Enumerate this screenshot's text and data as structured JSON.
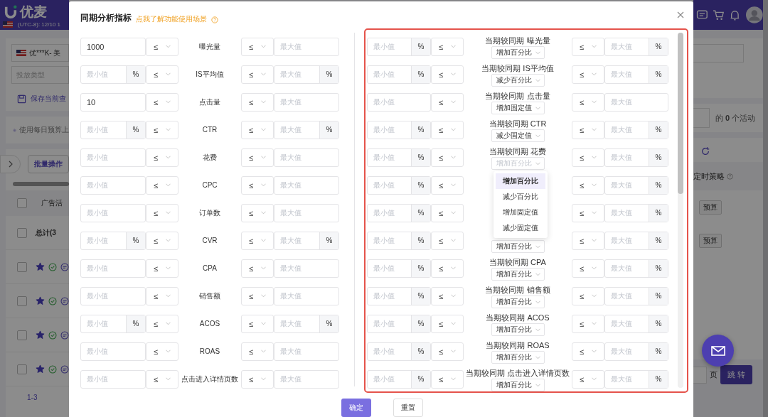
{
  "background": {
    "brand": "优麦",
    "timezone": "(UTC-8): 12/10 1",
    "store": "优***K- 美",
    "type_placeholder": "投放类型",
    "save_link": "保存当前查",
    "budget_note": "使用每日预算上",
    "batch_button": "批量操作",
    "table_header": "广告活",
    "total_row": "总计(3",
    "header_checked": false,
    "total_checked": false,
    "rows": [
      {
        "checked": false,
        "starred": true
      },
      {
        "checked": false,
        "starred": true
      },
      {
        "checked": false,
        "starred": true
      },
      {
        "checked": false,
        "starred": true
      }
    ],
    "pager": "1-3",
    "count_text": "的 **0** 个活动",
    "strategy_header": "定时策略",
    "budget_tags": [
      "预算",
      "预算"
    ],
    "page_label": "页",
    "jump_button": "跳 转"
  },
  "dialog": {
    "title": "同期分析指标",
    "help_link": "点我了解功能使用场景",
    "left_rows": [
      {
        "min_value": "1000",
        "min_op": "≤",
        "label": "曝光量",
        "max_op": "≤",
        "max_placeholder": "最大值"
      },
      {
        "min_placeholder": "最小值",
        "min_unit": "%",
        "min_op": "≤",
        "label": "IS平均值",
        "max_op": "≤",
        "max_placeholder": "最大值",
        "max_unit": "%"
      },
      {
        "min_value": "10",
        "min_op": "≤",
        "label": "点击量",
        "max_op": "≤",
        "max_placeholder": "最大值"
      },
      {
        "min_placeholder": "最小值",
        "min_unit": "%",
        "min_op": "≤",
        "label": "CTR",
        "max_op": "≤",
        "max_placeholder": "最大值",
        "max_unit": "%"
      },
      {
        "min_placeholder": "最小值",
        "min_op": "≤",
        "label": "花费",
        "max_op": "≤",
        "max_placeholder": "最大值"
      },
      {
        "min_placeholder": "最小值",
        "min_op": "≤",
        "label": "CPC",
        "max_op": "≤",
        "max_placeholder": "最大值"
      },
      {
        "min_placeholder": "最小值",
        "min_op": "≤",
        "label": "订单数",
        "max_op": "≤",
        "max_placeholder": "最大值"
      },
      {
        "min_placeholder": "最小值",
        "min_unit": "%",
        "min_op": "≤",
        "label": "CVR",
        "max_op": "≤",
        "max_placeholder": "最大值",
        "max_unit": "%"
      },
      {
        "min_placeholder": "最小值",
        "min_op": "≤",
        "label": "CPA",
        "max_op": "≤",
        "max_placeholder": "最大值"
      },
      {
        "min_placeholder": "最小值",
        "min_op": "≤",
        "label": "销售额",
        "max_op": "≤",
        "max_placeholder": "最大值"
      },
      {
        "min_placeholder": "最小值",
        "min_unit": "%",
        "min_op": "≤",
        "label": "ACOS",
        "max_op": "≤",
        "max_placeholder": "最大值",
        "max_unit": "%"
      },
      {
        "min_placeholder": "最小值",
        "min_op": "≤",
        "label": "ROAS",
        "max_op": "≤",
        "max_placeholder": "最大值"
      },
      {
        "min_placeholder": "最小值",
        "min_op": "≤",
        "label": "点击进入详情页数",
        "max_op": "≤",
        "max_placeholder": "最大值"
      }
    ],
    "right_rows": [
      {
        "min_placeholder": "最小值",
        "min_unit": "%",
        "min_op": "≤",
        "label": "当期较同期 曝光量",
        "change": "增加百分比",
        "open": false,
        "max_op": "≤",
        "max_placeholder": "最大值",
        "max_unit": "%"
      },
      {
        "min_placeholder": "最小值",
        "min_unit": "%",
        "min_op": "≤",
        "label": "当期较同期 IS平均值",
        "change": "减少百分比",
        "open": false,
        "max_op": "≤",
        "max_placeholder": "最大值",
        "max_unit": "%"
      },
      {
        "min_placeholder": "最小值",
        "min_op": "≤",
        "label": "当期较同期 点击量",
        "change": "增加固定值",
        "open": false,
        "max_op": "≤",
        "max_placeholder": "最大值"
      },
      {
        "min_placeholder": "最小值",
        "min_unit": "%",
        "min_op": "≤",
        "label": "当期较同期 CTR",
        "change": "减少固定值",
        "open": false,
        "max_op": "≤",
        "max_placeholder": "最大值",
        "max_unit": "%"
      },
      {
        "min_placeholder": "最小值",
        "min_unit": "%",
        "min_op": "≤",
        "label": "当期较同期 花费",
        "change": "增加百分比",
        "open": true,
        "max_op": "≤",
        "max_placeholder": "最大值",
        "max_unit": "%"
      },
      {
        "min_placeholder": "最小值",
        "min_unit": "%",
        "min_op": "≤",
        "max_op": "≤",
        "max_placeholder": "最大值",
        "max_unit": "%"
      },
      {
        "min_placeholder": "最小值",
        "min_unit": "%",
        "min_op": "≤",
        "max_op": "≤",
        "max_placeholder": "最大值",
        "max_unit": "%"
      },
      {
        "min_placeholder": "最小值",
        "min_unit": "%",
        "min_op": "≤",
        "change": "增加百分比",
        "open": false,
        "max_op": "≤",
        "max_placeholder": "最大值",
        "max_unit": "%"
      },
      {
        "min_placeholder": "最小值",
        "min_unit": "%",
        "min_op": "≤",
        "label": "当期较同期 CPA",
        "change": "增加百分比",
        "open": false,
        "max_op": "≤",
        "max_placeholder": "最大值",
        "max_unit": "%"
      },
      {
        "min_placeholder": "最小值",
        "min_unit": "%",
        "min_op": "≤",
        "label": "当期较同期 销售额",
        "change": "增加百分比",
        "open": false,
        "max_op": "≤",
        "max_placeholder": "最大值",
        "max_unit": "%"
      },
      {
        "min_placeholder": "最小值",
        "min_unit": "%",
        "min_op": "≤",
        "label": "当期较同期 ACOS",
        "change": "增加百分比",
        "open": false,
        "max_op": "≤",
        "max_placeholder": "最大值",
        "max_unit": "%"
      },
      {
        "min_placeholder": "最小值",
        "min_unit": "%",
        "min_op": "≤",
        "label": "当期较同期 ROAS",
        "change": "增加百分比",
        "open": false,
        "max_op": "≤",
        "max_placeholder": "最大值",
        "max_unit": "%"
      },
      {
        "min_placeholder": "最小值",
        "min_unit": "%",
        "min_op": "≤",
        "label": "当期较同期 点击进入详情页数",
        "change": "增加百分比",
        "open": false,
        "max_op": "≤",
        "max_placeholder": "最大值",
        "max_unit": "%"
      }
    ],
    "dropdown": [
      {
        "label": "增加百分比",
        "selected": true
      },
      {
        "label": "减少百分比",
        "selected": false
      },
      {
        "label": "增加固定值",
        "selected": false
      },
      {
        "label": "减少固定值",
        "selected": false
      }
    ],
    "buttons": [
      {
        "label": "确定",
        "kind": "primary"
      },
      {
        "label": "重置",
        "kind": "default"
      }
    ]
  }
}
